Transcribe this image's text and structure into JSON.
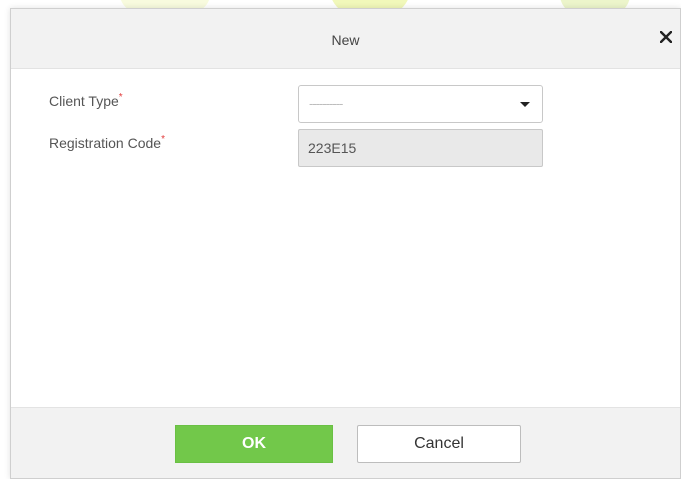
{
  "dialog": {
    "title": "New",
    "close_icon": "close-icon"
  },
  "form": {
    "client_type": {
      "label": "Client Type",
      "required_mark": "*",
      "selected_value": "----------",
      "icon": "chevron-down-icon"
    },
    "registration_code": {
      "label": "Registration Code",
      "required_mark": "*",
      "value": "223E15"
    }
  },
  "footer": {
    "ok_label": "OK",
    "cancel_label": "Cancel"
  },
  "colors": {
    "accent_ok": "#72c84a",
    "required": "#e23b3b",
    "header_bg": "#f2f2f2"
  }
}
